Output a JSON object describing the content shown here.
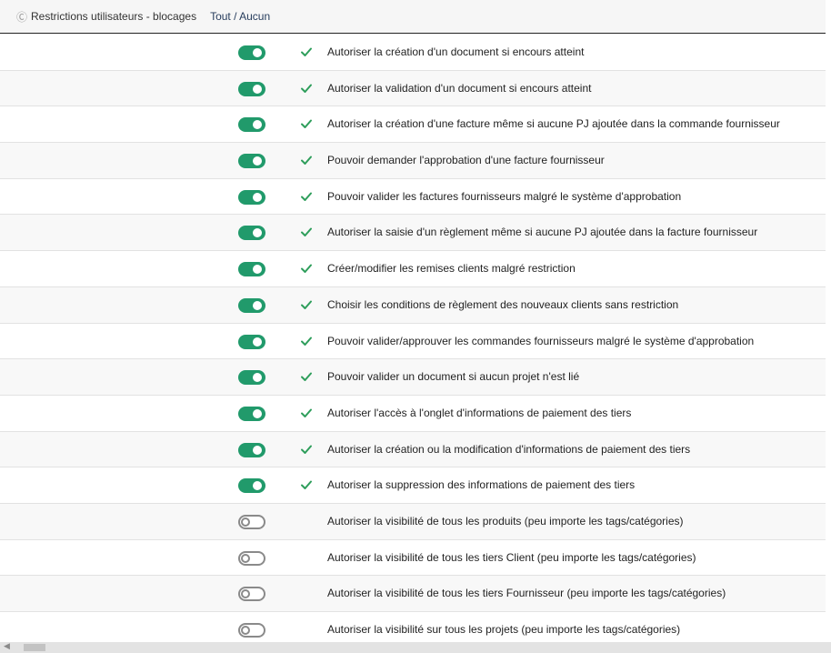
{
  "header": {
    "icon": "c-icon",
    "title": "Restrictions utilisateurs - blocages",
    "toggle_all_label": "Tout / Aucun"
  },
  "colors": {
    "toggle_on": "#219a6b",
    "toggle_off": "#8a8a8a",
    "check": "#2e9e5b"
  },
  "rows": [
    {
      "enabled": true,
      "checked": true,
      "label": "Autoriser la création d'un document si encours atteint"
    },
    {
      "enabled": true,
      "checked": true,
      "label": "Autoriser la validation d'un document si encours atteint"
    },
    {
      "enabled": true,
      "checked": true,
      "label": "Autoriser la création d'une facture même si aucune PJ ajoutée dans la commande fournisseur"
    },
    {
      "enabled": true,
      "checked": true,
      "label": "Pouvoir demander l'approbation d'une facture fournisseur"
    },
    {
      "enabled": true,
      "checked": true,
      "label": "Pouvoir valider les factures fournisseurs malgré le système d'approbation"
    },
    {
      "enabled": true,
      "checked": true,
      "label": "Autoriser la saisie d'un règlement même si aucune PJ ajoutée dans la facture fournisseur"
    },
    {
      "enabled": true,
      "checked": true,
      "label": "Créer/modifier les remises clients malgré restriction"
    },
    {
      "enabled": true,
      "checked": true,
      "label": "Choisir les conditions de règlement des nouveaux clients sans restriction"
    },
    {
      "enabled": true,
      "checked": true,
      "label": "Pouvoir valider/approuver les commandes fournisseurs malgré le système d'approbation"
    },
    {
      "enabled": true,
      "checked": true,
      "label": "Pouvoir valider un document si aucun projet n'est lié"
    },
    {
      "enabled": true,
      "checked": true,
      "label": "Autoriser l'accès à l'onglet d'informations de paiement des tiers"
    },
    {
      "enabled": true,
      "checked": true,
      "label": "Autoriser la création ou la modification d'informations de paiement des tiers"
    },
    {
      "enabled": true,
      "checked": true,
      "label": "Autoriser la suppression des informations de paiement des tiers"
    },
    {
      "enabled": false,
      "checked": false,
      "label": "Autoriser la visibilité de tous les produits (peu importe les tags/catégories)"
    },
    {
      "enabled": false,
      "checked": false,
      "label": "Autoriser la visibilité de tous les tiers Client (peu importe les tags/catégories)"
    },
    {
      "enabled": false,
      "checked": false,
      "label": "Autoriser la visibilité de tous les tiers Fournisseur (peu importe les tags/catégories)"
    },
    {
      "enabled": false,
      "checked": false,
      "label": "Autoriser la visibilité sur tous les projets (peu importe les tags/catégories)"
    }
  ]
}
